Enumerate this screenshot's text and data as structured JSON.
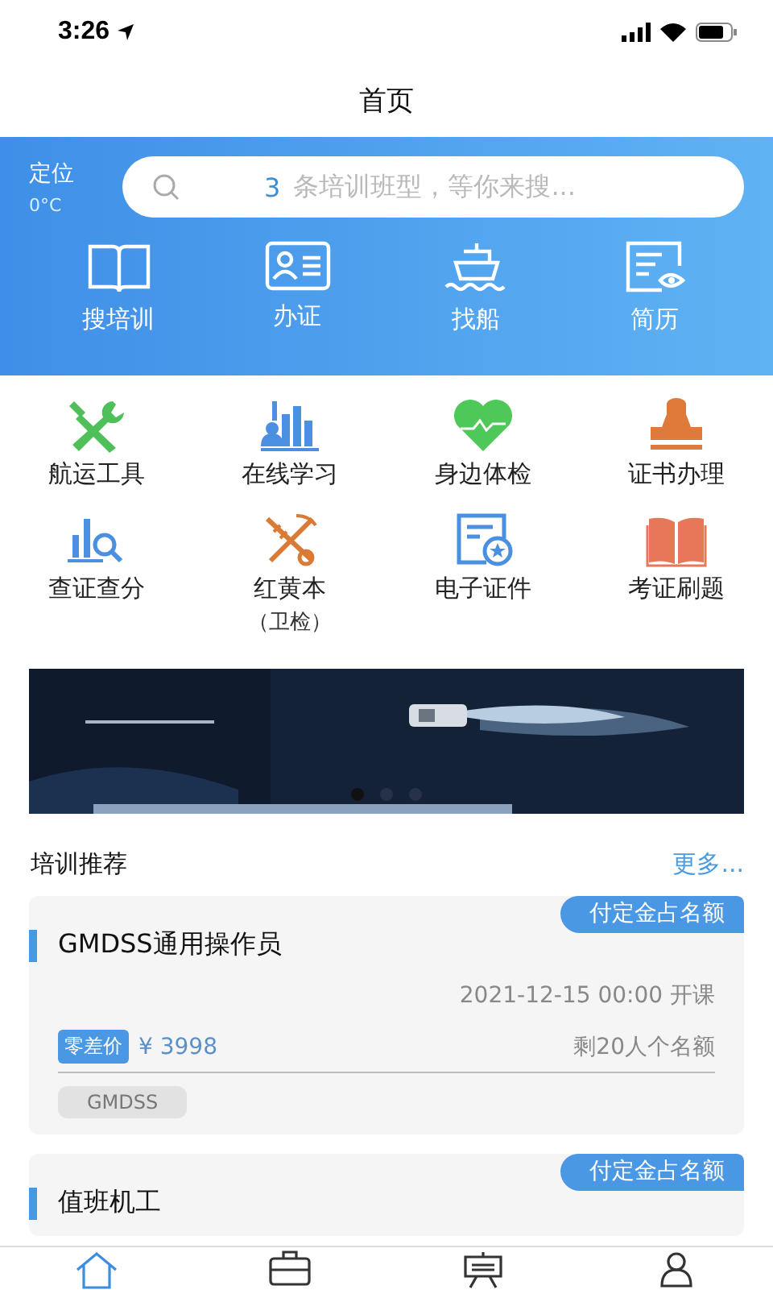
{
  "status_bar": {
    "time": "3:26"
  },
  "nav": {
    "title": "首页"
  },
  "header": {
    "location": "定位",
    "temperature": "0°C",
    "search": {
      "count": "3",
      "placeholder": "条培训班型，等你来搜..."
    },
    "shortcuts": [
      {
        "kind": "book",
        "label": "搜培训"
      },
      {
        "kind": "id-card",
        "label": "办证"
      },
      {
        "kind": "ship",
        "label": "找船"
      },
      {
        "kind": "resume",
        "label": "简历"
      }
    ]
  },
  "services": [
    {
      "kind": "tools",
      "label": "航运工具"
    },
    {
      "kind": "chart",
      "label": "在线学习"
    },
    {
      "kind": "heart",
      "label": "身边体检"
    },
    {
      "kind": "stamp",
      "label": "证书办理"
    },
    {
      "kind": "search-chart",
      "label": "查证查分"
    },
    {
      "kind": "caduceus",
      "label": "红黄本",
      "sublabel": "（卫检）"
    },
    {
      "kind": "certificate",
      "label": "电子证件"
    },
    {
      "kind": "open-book",
      "label": "考证刷题"
    }
  ],
  "banner": {
    "kind": "picture",
    "dots": [
      {
        "selected": true
      },
      {
        "selected": false
      },
      {
        "selected": false
      }
    ]
  },
  "section": {
    "title": "培训推荐",
    "more": "更多..."
  },
  "courses": [
    {
      "badge": "付定金占名额",
      "title": "GMDSS通用操作员",
      "start": "2021-12-15 00:00 开课",
      "price_tag": "零差价",
      "price": "¥ 3998",
      "remaining": "剩20人个名额",
      "tags": [
        "GMDSS"
      ]
    },
    {
      "badge": "付定金占名额",
      "title": "值班机工"
    }
  ],
  "tab_bar": [
    {
      "kind": "home",
      "selected": true
    },
    {
      "kind": "briefcase",
      "selected": false
    },
    {
      "kind": "board",
      "selected": false
    },
    {
      "kind": "person",
      "selected": false
    }
  ]
}
